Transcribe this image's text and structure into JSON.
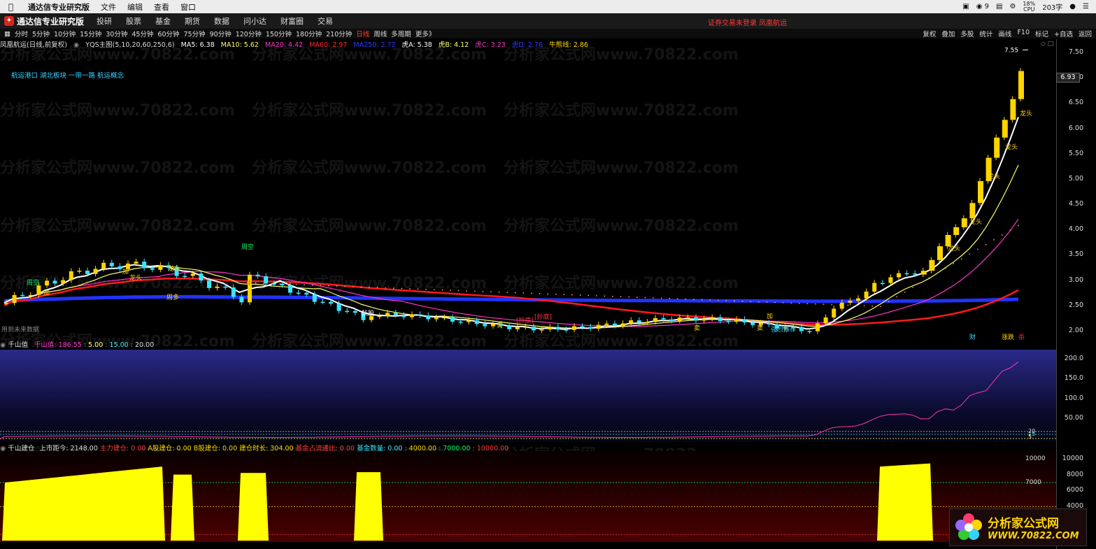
{
  "menubar": {
    "app_name": "通达信专业研究版",
    "items": [
      "文件",
      "编辑",
      "查看",
      "窗口"
    ],
    "status": {
      "wechat_count": "9",
      "cpu": "18%",
      "cpu_label": "CPU",
      "words": "203字"
    }
  },
  "titlebar": {
    "logo_text": "通达信专业研究版",
    "nav": [
      "投研",
      "股票",
      "基金",
      "期货",
      "数据",
      "问小达",
      "财富圈",
      "交易"
    ],
    "center_text": "证券交易未登录  凤凰航运"
  },
  "toolbar": {
    "periods": [
      "分时",
      "5分钟",
      "10分钟",
      "15分钟",
      "30分钟",
      "45分钟",
      "60分钟",
      "75分钟",
      "90分钟",
      "120分钟",
      "150分钟",
      "180分钟",
      "210分钟",
      "日线",
      "周线",
      "多周期",
      "更多"
    ],
    "active_period": "日线",
    "right": [
      "复权",
      "叠加",
      "多股",
      "统计",
      "画线",
      "F10",
      "标记",
      "+自选",
      "返回"
    ]
  },
  "main_info": {
    "stock": "凤凰航运(日线,前复权)",
    "indicator": "YQS主图(5,10,20,60,250,6)",
    "ma5": "MA5: 6.38",
    "ma10": "MA10: 5.62",
    "ma20": "MA20: 4.42",
    "ma60": "MA60: 2.97",
    "ma250": "MA250: 2.72",
    "hu_a": "虎A: 5.38",
    "hu_b": "虎B: 4.12",
    "hu_c": "虎C: 3.23",
    "hu_d": "虎D: 2.76",
    "niu": "牛熊线: 2.86"
  },
  "concepts": "航运港口  湖北板块  一带一路  航运概念",
  "no_data_text": "用到未来数据",
  "price_axis": [
    "7.50",
    "7.00",
    "6.50",
    "6.00",
    "5.50",
    "5.00",
    "4.50",
    "4.00",
    "3.50",
    "3.00",
    "2.50",
    "2.00"
  ],
  "current_price_tag": "6.93",
  "high_label": "7.55",
  "signals": [
    {
      "text": "周空",
      "color": "#00ff66"
    },
    {
      "text": "加",
      "color": "#ffd400"
    },
    {
      "text": "加",
      "color": "#ffd400"
    },
    {
      "text": "龙头",
      "color": "#ffd400"
    },
    {
      "text": "龙头",
      "color": "#ffd400"
    },
    {
      "text": "周空",
      "color": "#00ff66"
    },
    {
      "text": "周多",
      "color": "#ffd400"
    },
    {
      "text": "中",
      "color": "#ff3b3b"
    },
    {
      "text": "妖股",
      "color": "#ffffff"
    },
    {
      "text": "卖",
      "color": "#ffd400"
    },
    {
      "text": "[抄底]",
      "color": "#ff3b3b"
    },
    {
      "text": "[抄底]",
      "color": "#ff3b3b"
    },
    {
      "text": "卖",
      "color": "#ffd400"
    },
    {
      "text": "加",
      "color": "#ffd400"
    },
    {
      "text": "卖",
      "color": "#ffd400"
    },
    {
      "text": "强烈推荐",
      "color": "#39d0ff"
    },
    {
      "text": "龙头",
      "color": "#ffd400"
    },
    {
      "text": "龙头",
      "color": "#ffd400"
    },
    {
      "text": "龙头",
      "color": "#ffd400"
    },
    {
      "text": "龙头",
      "color": "#ffd400"
    },
    {
      "text": "龙头",
      "color": "#ffd400"
    },
    {
      "text": "财",
      "color": "#39d0ff"
    },
    {
      "text": "涨跌",
      "color": "#ffd400"
    },
    {
      "text": "杀",
      "color": "#ff3b3b"
    }
  ],
  "ind1": {
    "name": "千山值",
    "v1": "千山值: 186.55",
    "v2": "5.00",
    "v3": "15.00",
    "v4": "20.00",
    "axis": [
      "200.0",
      "150.0",
      "100.0",
      "50.00"
    ],
    "right_labels": [
      "20",
      "15",
      "5"
    ]
  },
  "ind2": {
    "name": "千山建仓",
    "listed_days": "上市距今: 2148.00",
    "main_build": "主力建仓: 0.00",
    "a_build": "A股建仓: 0.00",
    "b_build": "B股建仓: 0.00",
    "build_duration": "建仓时长: 304.00",
    "fund_ratio": "基金占流通比: 0.00",
    "fund_count": "基金数量: 0.00",
    "v4000": "4000.00",
    "v7000": "7000.00",
    "v10000": "10000.00",
    "axis": [
      "10000",
      "8000",
      "6000",
      "4000"
    ],
    "inner_axis": [
      "10000",
      "7000"
    ]
  },
  "watermark": "分析家公式网www.70822.com",
  "brand": {
    "title": "分析家公式网",
    "url": "WWW.70822.COM"
  },
  "colors": {
    "up": "#ffd400",
    "down": "#39e6ff",
    "ma5": "#ffffff",
    "ma10": "#ffff66",
    "ma20": "#ff33cc",
    "ma60": "#ff1a1a",
    "ma250": "#2233ff"
  }
}
